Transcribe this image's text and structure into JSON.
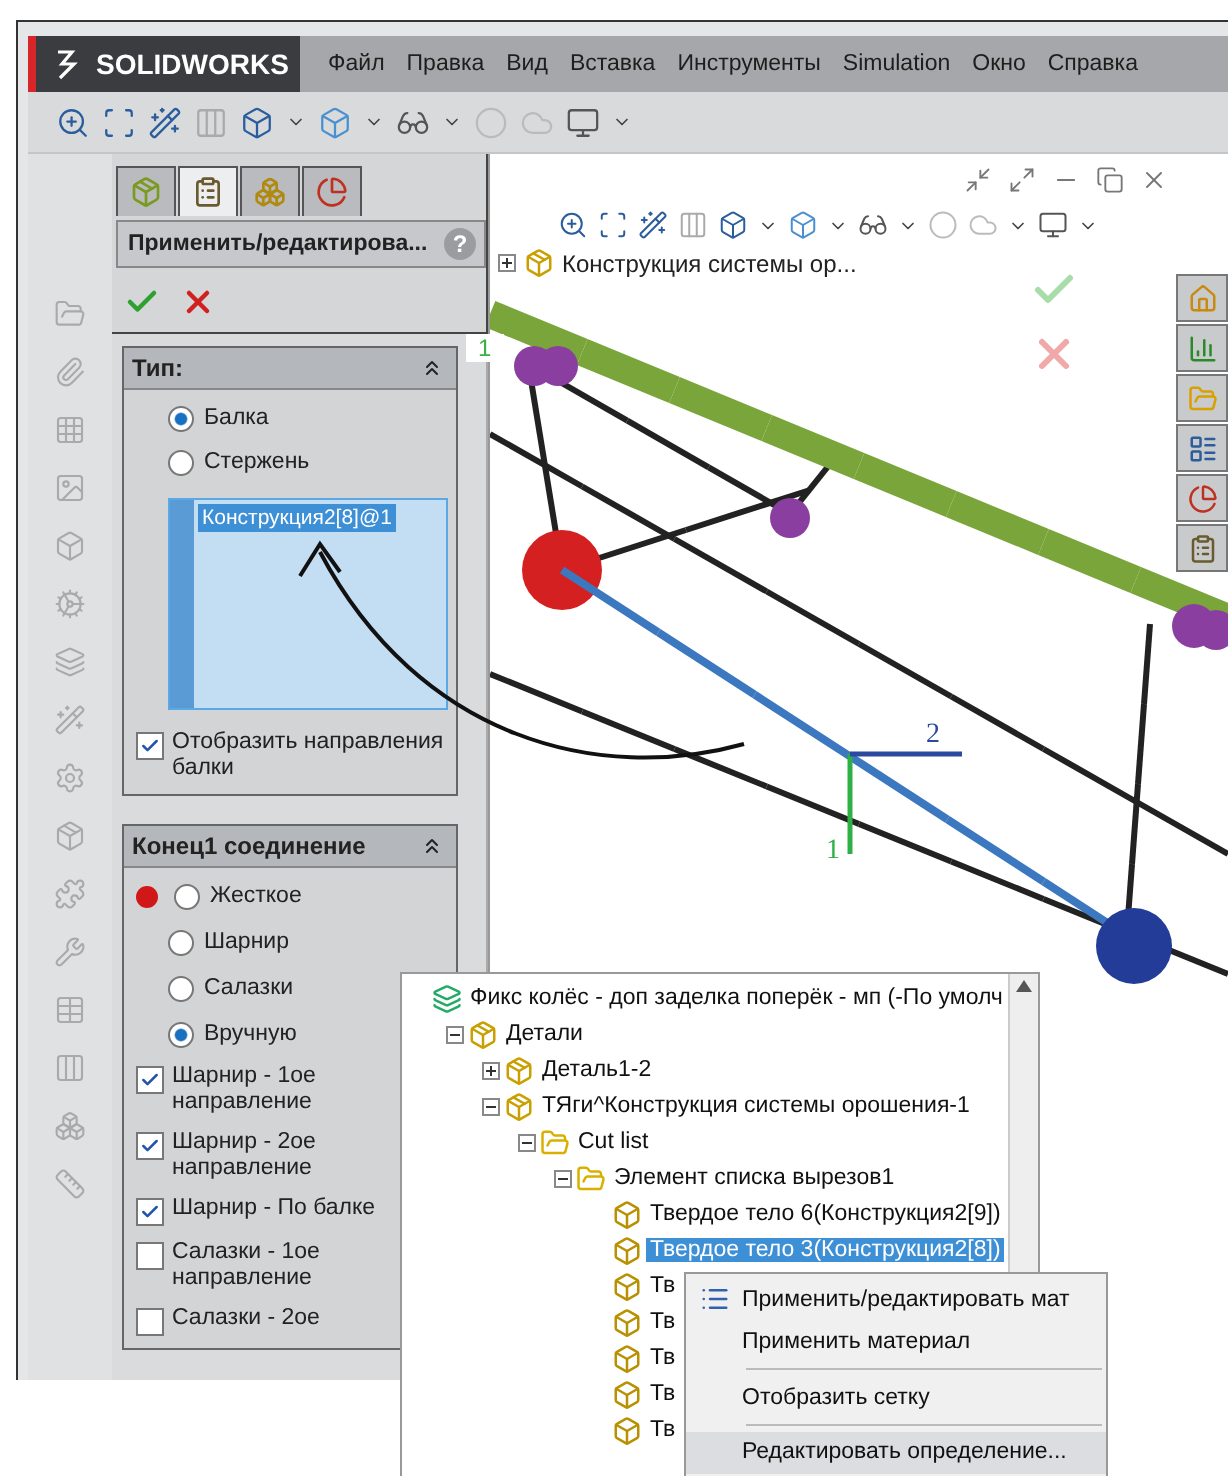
{
  "app": {
    "logo": "SOLIDWORKS",
    "menu": [
      "Файл",
      "Правка",
      "Вид",
      "Вставка",
      "Инструменты",
      "Simulation",
      "Окно",
      "Справка"
    ]
  },
  "property_manager": {
    "tabs": [
      {
        "kind": "feature",
        "selected": false
      },
      {
        "kind": "property",
        "selected": true
      },
      {
        "kind": "config",
        "selected": false
      },
      {
        "kind": "display",
        "selected": false
      }
    ],
    "title": "Применить/редактирова...",
    "help": "?",
    "type_group": {
      "title": "Тип:",
      "options": [
        {
          "label": "Балка",
          "selected": true
        },
        {
          "label": "Стержень",
          "selected": false
        }
      ],
      "selection": [
        "Конструкция2[8]@1"
      ],
      "show_direction": {
        "label": "Отобразить направления балки",
        "checked": true
      }
    },
    "end_group": {
      "title": "Конец1 соединение",
      "options": [
        {
          "label": "Жесткое",
          "selected": false
        },
        {
          "label": "Шарнир",
          "selected": false
        },
        {
          "label": "Салазки",
          "selected": false
        },
        {
          "label": "Вручную",
          "selected": true
        }
      ],
      "checkboxes": [
        {
          "label": "Шарнир - 1ое направление",
          "checked": true
        },
        {
          "label": "Шарнир - 2ое направление",
          "checked": true
        },
        {
          "label": "Шарнир - По балке",
          "checked": true
        },
        {
          "label": "Салазки - 1ое направление",
          "checked": false
        },
        {
          "label": "Салазки - 2ое",
          "checked": false
        }
      ]
    }
  },
  "viewport": {
    "tree_label": "Конструкция системы ор...",
    "tree_expanded": false,
    "corner_label": "1",
    "axis_labels": [
      "1",
      "2"
    ]
  },
  "tree": {
    "label": "Фикс колёс - доп заделка поперёк - мп (-По умолч",
    "kind": "root",
    "selected": false,
    "children": [
      {
        "label": "Детали",
        "kind": "part",
        "expanded": true,
        "selected": false,
        "children": [
          {
            "label": "Деталь1-2",
            "kind": "part",
            "expanded": false,
            "selected": false
          },
          {
            "label": "ТЯги^Конструкция системы орошения-1",
            "kind": "part",
            "expanded": true,
            "selected": false,
            "children": [
              {
                "label": "Cut list",
                "kind": "folder",
                "expanded": true,
                "selected": false,
                "children": [
                  {
                    "label": "Элемент списка вырезов1",
                    "kind": "folder",
                    "expanded": true,
                    "selected": false,
                    "children": [
                      {
                        "label": "Твердое тело 6(Конструкция2[9])",
                        "kind": "body",
                        "selected": false
                      },
                      {
                        "label": "Твердое тело 3(Конструкция2[8])",
                        "kind": "body",
                        "selected": true
                      },
                      {
                        "label": "Тв",
                        "kind": "body",
                        "selected": false
                      },
                      {
                        "label": "Тв",
                        "kind": "body",
                        "selected": false
                      },
                      {
                        "label": "Тв",
                        "kind": "body",
                        "selected": false
                      },
                      {
                        "label": "Тв",
                        "kind": "body",
                        "selected": false
                      },
                      {
                        "label": "Тв",
                        "kind": "body",
                        "selected": false
                      }
                    ]
                  }
                ]
              }
            ]
          }
        ]
      }
    ]
  },
  "context_menu": [
    {
      "kind": "item",
      "label": "Применить/редактировать мат",
      "icon": true,
      "selected": false
    },
    {
      "kind": "item",
      "label": "Применить материал",
      "icon": false,
      "selected": false
    },
    {
      "kind": "separator"
    },
    {
      "kind": "item",
      "label": "Отобразить сетку",
      "icon": false,
      "selected": false
    },
    {
      "kind": "separator"
    },
    {
      "kind": "item",
      "label": "Редактировать определение...",
      "icon": false,
      "selected": true
    }
  ]
}
